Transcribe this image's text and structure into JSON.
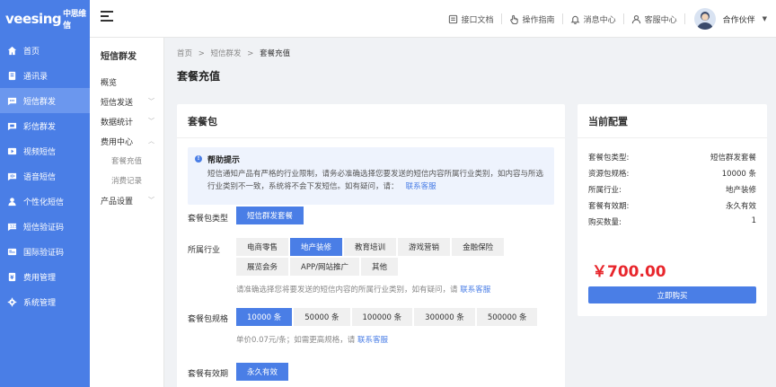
{
  "brand": {
    "logo_text": "veesing",
    "logo_cn": "中思维信"
  },
  "sidebar": {
    "items": [
      {
        "label": "首页",
        "icon": "home-icon"
      },
      {
        "label": "通讯录",
        "icon": "contacts-icon"
      },
      {
        "label": "短信群发",
        "icon": "sms-icon",
        "active": true
      },
      {
        "label": "彩信群发",
        "icon": "mms-icon"
      },
      {
        "label": "视频短信",
        "icon": "video-icon"
      },
      {
        "label": "语音短信",
        "icon": "voice-icon"
      },
      {
        "label": "个性化短信",
        "icon": "user-sms-icon"
      },
      {
        "label": "短信验证码",
        "icon": "code-icon"
      },
      {
        "label": "国际验证码",
        "icon": "globe-icon"
      },
      {
        "label": "费用管理",
        "icon": "fee-icon"
      },
      {
        "label": "系统管理",
        "icon": "settings-icon"
      }
    ]
  },
  "header": {
    "tools": [
      {
        "label": "接口文档",
        "icon": "doc-icon"
      },
      {
        "label": "操作指南",
        "icon": "hand-icon"
      },
      {
        "label": "消息中心",
        "icon": "bell-icon"
      },
      {
        "label": "客服中心",
        "icon": "service-icon"
      }
    ],
    "user_name": "合作伙伴"
  },
  "subnav": {
    "title": "短信群发",
    "items": [
      {
        "label": "概览",
        "chevron": ""
      },
      {
        "label": "短信发送",
        "chevron": "down"
      },
      {
        "label": "数据统计",
        "chevron": "down"
      },
      {
        "label": "费用中心",
        "chevron": "up"
      },
      {
        "label": "套餐充值",
        "child": true
      },
      {
        "label": "消费记录",
        "child": true
      },
      {
        "label": "产品设置",
        "chevron": "down"
      }
    ]
  },
  "breadcrumb": {
    "items": [
      "首页",
      "短信群发",
      "套餐充值"
    ],
    "sep": ">"
  },
  "page_title": "套餐充值",
  "package_card": {
    "title": "套餐包",
    "help_title": "帮助提示",
    "help_text": "短信通知产品有严格的行业限制，请务必准确选择您要发送的短信内容所属行业类别，如内容与所选行业类别不一致，系统将不会下发短信。如有疑问，请：",
    "help_link": "联系客服",
    "type_label": "套餐包类型",
    "type_options": [
      "短信群发套餐"
    ],
    "industry_label": "所属行业",
    "industry_options": [
      "电商零售",
      "地产装修",
      "教育培训",
      "游戏营销",
      "金融保险",
      "展览会务",
      "APP/网站推广",
      "其他"
    ],
    "industry_selected": "地产装修",
    "industry_hint": "请准确选择您将要发送的短信内容的所属行业类别，如有疑问，请",
    "industry_hint_link": "联系客服",
    "spec_label": "套餐包规格",
    "spec_options": [
      "10000 条",
      "50000 条",
      "100000 条",
      "300000 条",
      "500000 条"
    ],
    "spec_selected": "10000 条",
    "spec_hint": "单价0.07元/条；如需更高规格，请",
    "spec_hint_link": "联系客服",
    "validity_label": "套餐有效期",
    "validity_options": [
      "永久有效"
    ]
  },
  "config_card": {
    "title": "当前配置",
    "rows": [
      {
        "label": "套餐包类型:",
        "value": "短信群发套餐"
      },
      {
        "label": "资源包规格:",
        "value": "10000 条"
      },
      {
        "label": "所属行业:",
        "value": "地产装修"
      },
      {
        "label": "套餐有效期:",
        "value": "永久有效"
      },
      {
        "label": "购买数量:",
        "value": "1"
      }
    ],
    "price": "￥700.00",
    "buy_label": "立即购买"
  },
  "colors": {
    "primary": "#4a7ee6",
    "price": "#e8262c",
    "sidebar_active": "#6b97ee"
  }
}
